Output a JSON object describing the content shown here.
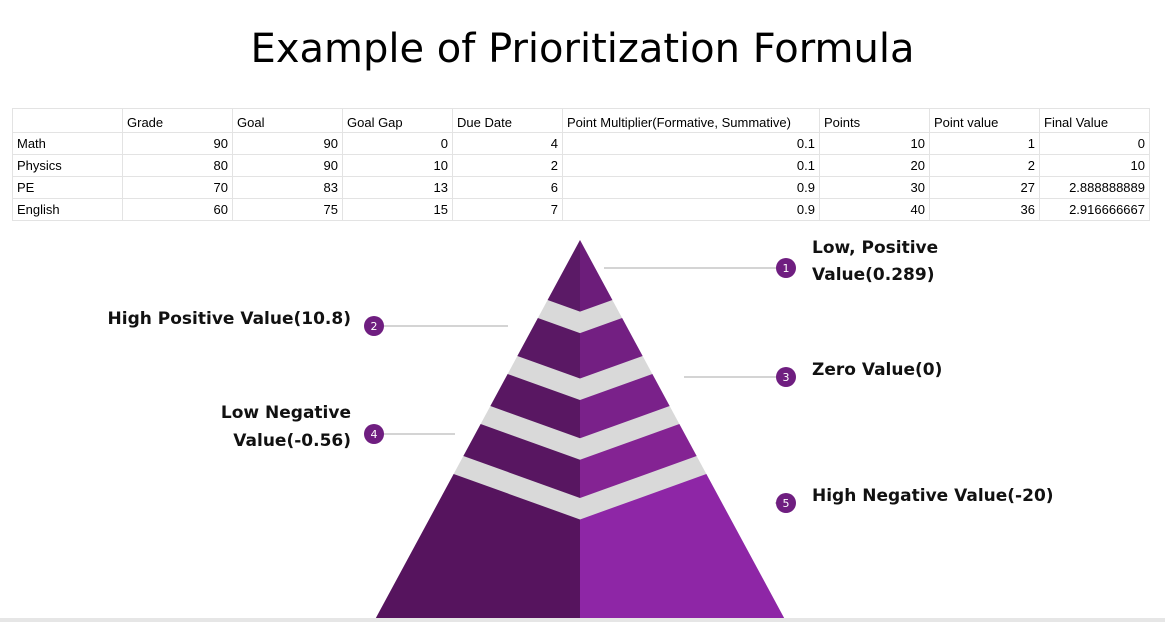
{
  "title": "Example of Prioritization Formula",
  "table": {
    "headers": [
      "",
      "Grade",
      "Goal",
      "Goal Gap",
      "Due Date",
      "Point Multiplier(Formative, Summative)",
      "Points",
      "Point value",
      "Final Value"
    ],
    "rows": [
      [
        "Math",
        "90",
        "90",
        "0",
        "4",
        "0.1",
        "10",
        "1",
        "0"
      ],
      [
        "Physics",
        "80",
        "90",
        "10",
        "2",
        "0.1",
        "20",
        "2",
        "10"
      ],
      [
        "PE",
        "70",
        "83",
        "13",
        "6",
        "0.9",
        "30",
        "27",
        "2.888888889"
      ],
      [
        "English",
        "60",
        "75",
        "15",
        "7",
        "0.9",
        "40",
        "36",
        "2.916666667"
      ]
    ]
  },
  "pyramid": {
    "colors": {
      "left_shades": [
        "#5b1a66",
        "#5a1864",
        "#591762",
        "#581661",
        "#56145e"
      ],
      "right_shades": [
        "#6c1d7a",
        "#731f82",
        "#7a218a",
        "#842393",
        "#8e26a6"
      ],
      "separator": "#d9d9d9",
      "badge": "#6f1e80",
      "leader": "#a8a8a8"
    },
    "callouts": [
      {
        "number": "1",
        "lines": [
          "Low, Positive",
          "Value(0.289)"
        ]
      },
      {
        "number": "2",
        "lines": [
          "High Positive Value(10.8)"
        ]
      },
      {
        "number": "3",
        "lines": [
          "Zero Value(0)"
        ]
      },
      {
        "number": "4",
        "lines": [
          "Low Negative",
          "Value(-0.56)"
        ]
      },
      {
        "number": "5",
        "lines": [
          "High Negative Value(-20)"
        ]
      }
    ]
  }
}
